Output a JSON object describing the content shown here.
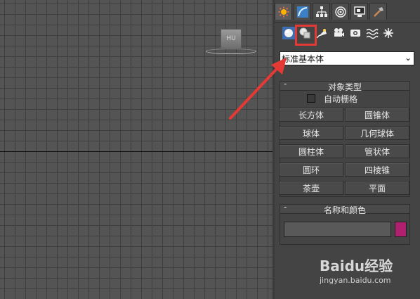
{
  "viewport": {
    "view_cube_label": "HU"
  },
  "command_panel": {
    "tabs": [
      {
        "icon": "create-icon",
        "active": true
      },
      {
        "icon": "modify-icon"
      },
      {
        "icon": "hierarchy-icon"
      },
      {
        "icon": "motion-icon"
      },
      {
        "icon": "display-icon"
      },
      {
        "icon": "utilities-icon"
      }
    ],
    "subcategories": [
      {
        "icon": "geometry-icon"
      },
      {
        "icon": "shapes-icon",
        "highlighted": true
      },
      {
        "icon": "lights-icon"
      },
      {
        "icon": "cameras-icon"
      },
      {
        "icon": "helpers-icon"
      },
      {
        "icon": "space-warps-icon"
      },
      {
        "icon": "systems-icon"
      }
    ],
    "category_select": {
      "value": "标准基本体"
    },
    "object_type": {
      "title": "对象类型",
      "toggle": "-",
      "autogrid_label": "自动栅格",
      "buttons": [
        "长方体",
        "圆锥体",
        "球体",
        "几何球体",
        "圆柱体",
        "管状体",
        "圆环",
        "四棱锥",
        "茶壶",
        "平面"
      ]
    },
    "name_and_color": {
      "title": "名称和颜色",
      "toggle": "-",
      "name_value": "",
      "color": "#b0206e"
    }
  },
  "annotation": {
    "arrow_color": "#e53935"
  },
  "watermark": {
    "logo": "Baidu经验",
    "site": "jingyan.baidu.com"
  }
}
